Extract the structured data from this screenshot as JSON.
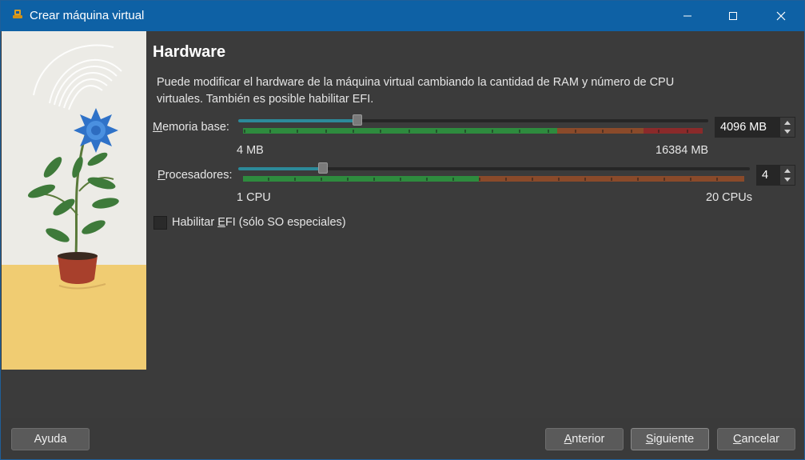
{
  "window": {
    "title": "Crear máquina virtual",
    "controls": {
      "minimize": "minimize-icon",
      "maximize": "maximize-icon",
      "close": "close-icon"
    }
  },
  "page": {
    "heading": "Hardware",
    "description": "Puede modificar el hardware de la máquina virtual cambiando la cantidad de RAM y número de CPU virtuales. También es posible habilitar EFI."
  },
  "memory": {
    "label_prefix": "M",
    "label_rest": "emoria base:",
    "value": "4096 MB",
    "min_label": "4 MB",
    "max_label": "16384 MB",
    "slider_fraction": 0.25
  },
  "cpu": {
    "label_prefix": "P",
    "label_rest": "rocesadores:",
    "value": "4",
    "min_label": "1 CPU",
    "max_label": "20 CPUs",
    "slider_fraction": 0.16
  },
  "efi": {
    "label_before": "Habilitar ",
    "label_underlined": "E",
    "label_after": "FI (sólo SO especiales)",
    "checked": false
  },
  "buttons": {
    "help": "Ayuda",
    "back_prefix": "A",
    "back_rest": "nterior",
    "next_prefix": "S",
    "next_rest": "iguiente",
    "cancel_prefix": "C",
    "cancel_rest": "ancelar"
  },
  "colors": {
    "titlebar": "#0e61a5",
    "scale_green": "#2e8b3e",
    "scale_orange": "#8a4a2a",
    "scale_red": "#8a2a2a",
    "slider_fill": "#2c8a9a"
  }
}
